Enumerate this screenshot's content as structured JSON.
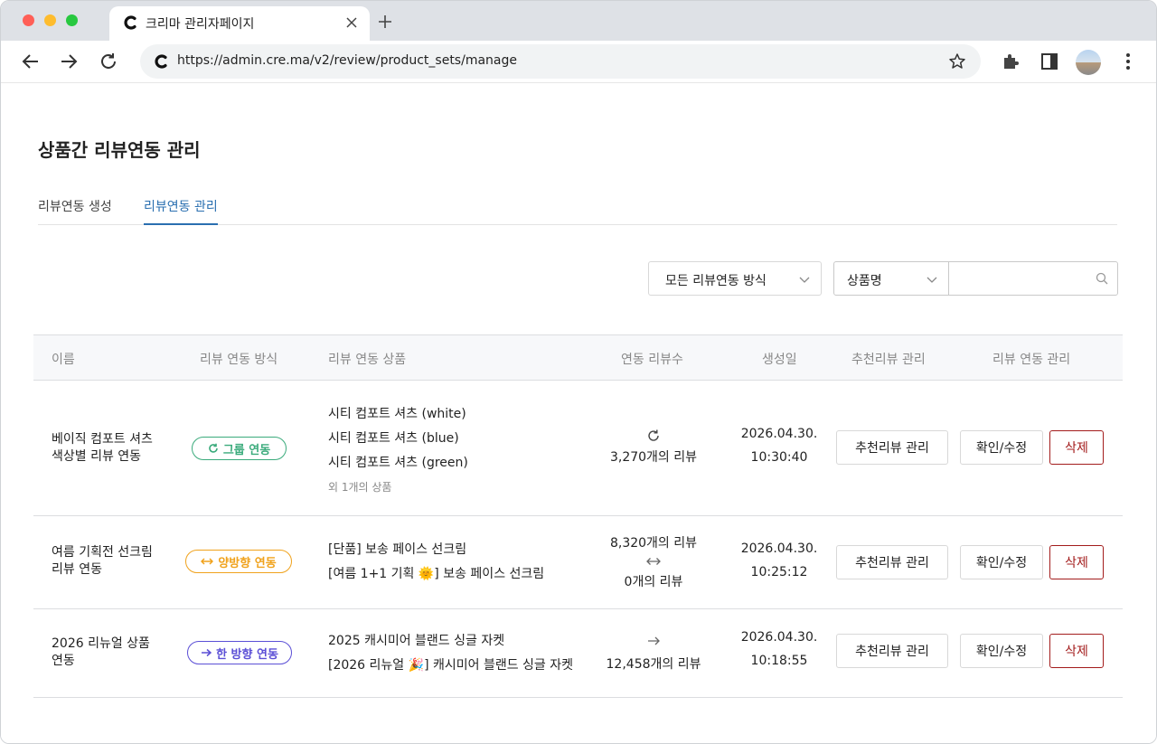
{
  "browser": {
    "tab_title": "크리마 관리자페이지",
    "url": "https://admin.cre.ma/v2/review/product_sets/manage"
  },
  "page": {
    "title": "상품간 리뷰연동 관리",
    "tabs": [
      {
        "label": "리뷰연동 생성",
        "active": false
      },
      {
        "label": "리뷰연동 관리",
        "active": true
      }
    ]
  },
  "filters": {
    "method_select": "모든 리뷰연동 방식",
    "search_type": "상품명",
    "search_value": ""
  },
  "table": {
    "headers": [
      "이름",
      "리뷰 연동 방식",
      "리뷰 연동 상품",
      "연동 리뷰수",
      "생성일",
      "추천리뷰 관리",
      "리뷰 연동 관리"
    ],
    "rows": [
      {
        "name_line1": "베이직 컴포트 셔츠",
        "name_line2": "색상별 리뷰 연동",
        "method": "그룹 연동",
        "method_color": "#3bab7c",
        "products": [
          "시티 컴포트 셔츠 (white)",
          "시티 컴포트 셔츠 (blue)",
          "시티 컴포트 셔츠 (green)"
        ],
        "more": "외 1개의 상품",
        "count_icon": "sync-icon",
        "count_a": "3,270개의 리뷰",
        "date": "2026.04.30.",
        "time": "10:30:40"
      },
      {
        "name_line1": "여름 기획전 선크림",
        "name_line2": "리뷰 연동",
        "method": "양방향 연동",
        "method_color": "#f0a21c",
        "products": [
          "[단품] 보송 페이스 선크림",
          "[여름 1+1 기획 🌞] 보송 페이스 선크림"
        ],
        "count_a": "8,320개의 리뷰",
        "count_icon": "bidirectional-arrow-icon",
        "count_b": "0개의 리뷰",
        "date": "2026.04.30.",
        "time": "10:25:12"
      },
      {
        "name_line1": "2026 리뉴얼 상품",
        "name_line2": "연동",
        "method": "한 방향 연동",
        "method_color": "#5b4fd6",
        "products": [
          "2025 캐시미어 블랜드 싱글 자켓",
          "[2026 리뉴얼 🎉] 캐시미어 블랜드 싱글 자켓"
        ],
        "count_icon": "right-arrow-icon",
        "count_a": "12,458개의 리뷰",
        "date": "2026.04.30.",
        "time": "10:18:55"
      }
    ],
    "btn_recommend": "추천리뷰 관리",
    "btn_edit": "확인/수정",
    "btn_delete": "삭제"
  }
}
